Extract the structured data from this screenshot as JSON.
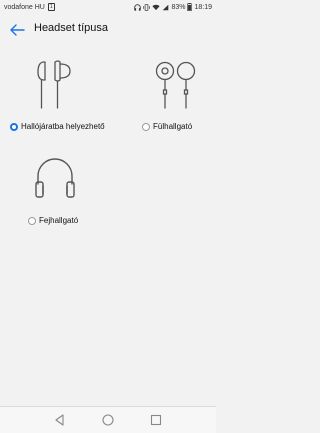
{
  "status_bar": {
    "carrier": "vodafone HU",
    "carrier_badge": "1",
    "battery": "83%",
    "time": "18:19"
  },
  "header": {
    "title": "Headset típusa"
  },
  "options": [
    {
      "label": "Hallójáratba helyezhető",
      "selected": true,
      "icon": "in-ear-headphones-icon"
    },
    {
      "label": "Fülhallgató",
      "selected": false,
      "icon": "earbuds-icon"
    },
    {
      "label": "Fejhallgató",
      "selected": false,
      "icon": "over-ear-headphones-icon"
    }
  ],
  "colors": {
    "accent": "#1a73e8",
    "background": "#f2f2f2"
  }
}
